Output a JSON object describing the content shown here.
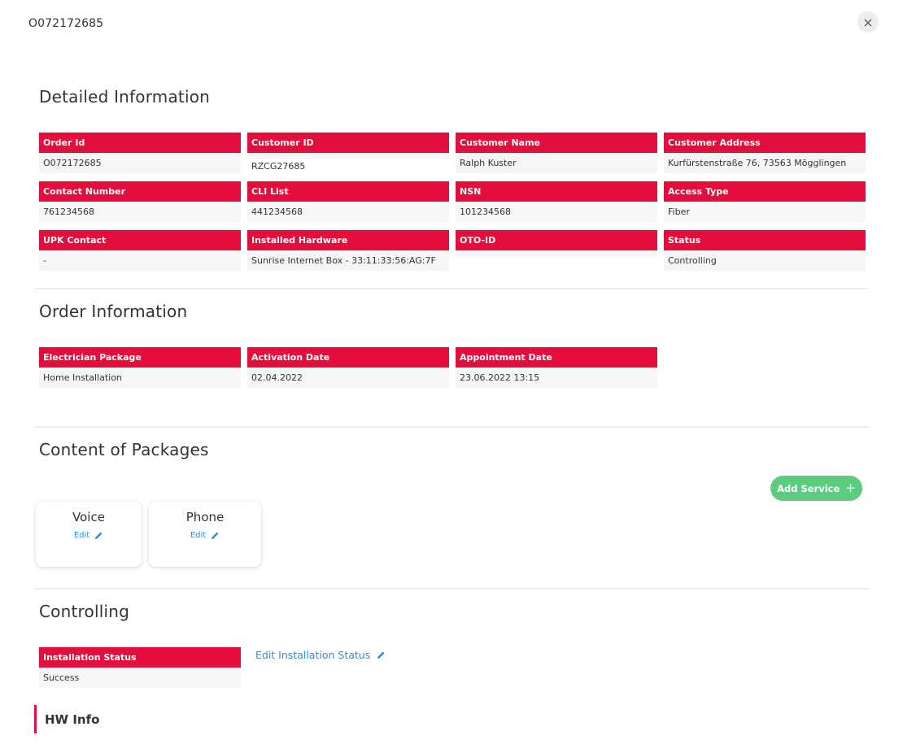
{
  "header": {
    "title": "O072172685",
    "close_icon": "close-icon"
  },
  "detailed_information": {
    "title": "Detailed Information",
    "fields": [
      {
        "label": "Order Id",
        "value": "O072172685"
      },
      {
        "label": "Customer ID",
        "value": "RZCG27685"
      },
      {
        "label": "Customer Name",
        "value": "Ralph Kuster"
      },
      {
        "label": "Customer Address",
        "value": "Kurfürstenstraße 76, 73563 Mögglingen"
      },
      {
        "label": "Contact Number",
        "value": "761234568"
      },
      {
        "label": "CLI List",
        "value": "441234568"
      },
      {
        "label": "NSN",
        "value": "101234568"
      },
      {
        "label": "Access Type",
        "value": "Fiber"
      },
      {
        "label": "UPK Contact",
        "value": "-"
      },
      {
        "label": "Installed Hardware",
        "value": "Sunrise Internet Box - 33:11:33:56:AG:7F"
      },
      {
        "label": "OTO-ID",
        "value": ""
      },
      {
        "label": "Status",
        "value": "Controlling"
      }
    ]
  },
  "order_information": {
    "title": "Order Information",
    "fields": [
      {
        "label": "Electrician Package",
        "value": "Home Installation"
      },
      {
        "label": "Activation Date",
        "value": "02.04.2022"
      },
      {
        "label": "Appointment Date",
        "value": "23.06.2022 13:15"
      }
    ]
  },
  "content_of_packages": {
    "title": "Content of Packages",
    "add_service_label": "Add Service",
    "add_service_icon": "plus-icon",
    "packages": [
      {
        "name": "Voice",
        "edit_label": "Edit",
        "edit_icon": "pencil-icon"
      },
      {
        "name": "Phone",
        "edit_label": "Edit",
        "edit_icon": "pencil-icon"
      }
    ]
  },
  "controlling": {
    "title": "Controlling",
    "installation_status": {
      "label": "Installation Status",
      "value": "Success"
    },
    "edit_link_label": "Edit Installation Status",
    "edit_icon": "pencil-icon"
  },
  "hw_info": {
    "title": "HW Info"
  },
  "colors": {
    "label_background": "#e30e3c",
    "value_background": "#f6f6f6",
    "link": "#2b8fe0",
    "add_service": "#5ccc7f"
  }
}
